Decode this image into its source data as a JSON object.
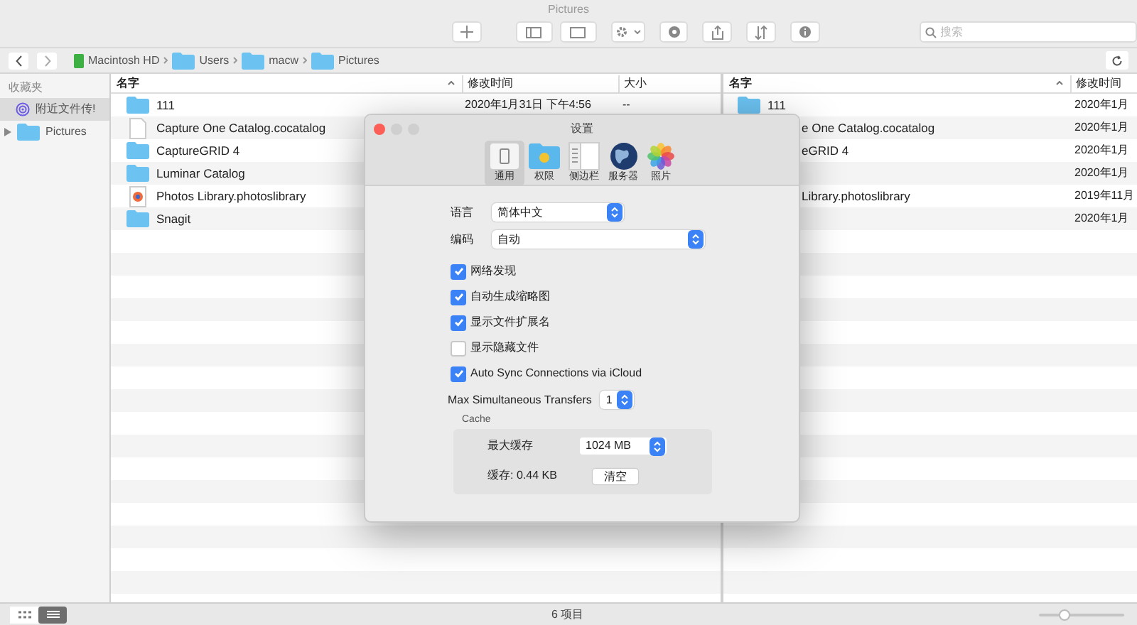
{
  "window": {
    "title": "Pictures"
  },
  "toolbar": {
    "search": {
      "placeholder": "搜索"
    }
  },
  "path_bar": {
    "crumbs": [
      {
        "label": "Macintosh HD",
        "kind": "disk"
      },
      {
        "label": "Users",
        "kind": "folder"
      },
      {
        "label": "macw",
        "kind": "folder"
      },
      {
        "label": "Pictures",
        "kind": "folder"
      }
    ]
  },
  "sidebar": {
    "heading": "收藏夹",
    "items": [
      {
        "label": "附近文件传!",
        "kind": "airdrop",
        "selected": true
      },
      {
        "label": "Pictures",
        "kind": "folder",
        "selected": false
      }
    ]
  },
  "left_pane": {
    "columns": [
      "名字",
      "修改时间",
      "大小"
    ],
    "rows": [
      {
        "name": "111",
        "kind": "folder",
        "modified": "2020年1月31日 下午4:56",
        "size": "--"
      },
      {
        "name": "Capture One Catalog.cocatalog",
        "kind": "document"
      },
      {
        "name": "CaptureGRID 4",
        "kind": "folder"
      },
      {
        "name": "Luminar Catalog",
        "kind": "folder"
      },
      {
        "name": "Photos Library.photoslibrary",
        "kind": "photos"
      },
      {
        "name": "Snagit",
        "kind": "folder"
      }
    ]
  },
  "right_pane": {
    "columns": [
      "名字",
      "修改时间"
    ],
    "rows": [
      {
        "name": "111",
        "kind": "folder",
        "modified": "2020年1月"
      },
      {
        "name": "e One Catalog.cocatalog",
        "kind": "clipped",
        "modified": "2020年1月"
      },
      {
        "name": "eGRID 4",
        "kind": "clipped",
        "modified": "2020年1月"
      },
      {
        "kind": "hidden",
        "modified": "2020年1月"
      },
      {
        "name": "Library.photoslibrary",
        "kind": "clipped",
        "modified": "2019年11月"
      },
      {
        "kind": "hidden",
        "modified": "2020年1月"
      }
    ]
  },
  "settings_dialog": {
    "title": "设置",
    "tabs": [
      {
        "label": "通用",
        "kind": "general",
        "selected": true
      },
      {
        "label": "权限",
        "kind": "permissions",
        "selected": false
      },
      {
        "label": "侧边栏",
        "kind": "sidebar",
        "selected": false
      },
      {
        "label": "服务器",
        "kind": "server",
        "selected": false
      },
      {
        "label": "照片",
        "kind": "photos",
        "selected": false
      }
    ],
    "language": {
      "label": "语言",
      "value": "简体中文"
    },
    "encoding": {
      "label": "编码",
      "value": "自动"
    },
    "options": [
      {
        "label": "网络发现",
        "checked": true
      },
      {
        "label": "自动生成缩略图",
        "checked": true
      },
      {
        "label": "显示文件扩展名",
        "checked": true
      },
      {
        "label": "显示隐藏文件",
        "checked": false
      },
      {
        "label": "Auto Sync Connections via iCloud",
        "checked": true
      }
    ],
    "max_transfers": {
      "label": "Max Simultaneous Transfers",
      "value": "1"
    },
    "cache": {
      "title": "Cache",
      "max_label": "最大缓存",
      "max_value": "1024 MB",
      "usage": "缓存: 0.44 KB",
      "clear_button": "清空"
    }
  },
  "status_bar": {
    "views": [
      {
        "kind": "icons",
        "selected": false
      },
      {
        "kind": "list",
        "selected": true
      }
    ],
    "item_count": "6 项目",
    "zoom": {
      "level": 0.3
    }
  }
}
